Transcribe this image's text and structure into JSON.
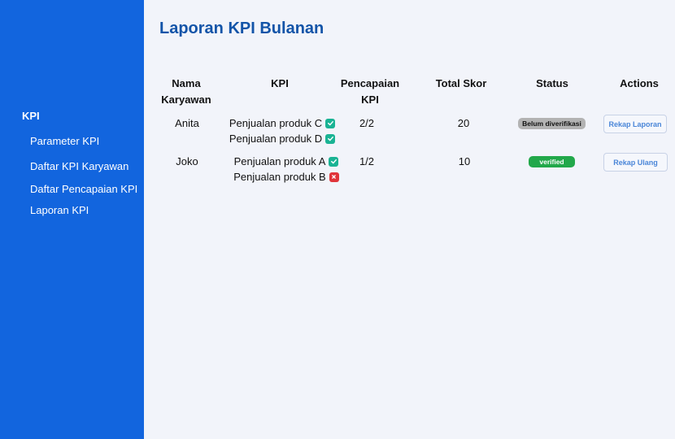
{
  "sidebar": {
    "section_label": "KPI",
    "items": [
      {
        "label": "Parameter KPI"
      },
      {
        "label": "Daftar KPI Karyawan"
      },
      {
        "label": "Daftar Pencapaian KPI"
      },
      {
        "label": "Laporan KPI"
      }
    ]
  },
  "page": {
    "title": "Laporan KPI Bulanan"
  },
  "table": {
    "headers": {
      "nama_line1": "Nama",
      "nama_line2": "Karyawan",
      "kpi": "KPI",
      "pencapaian_line1": "Pencapaian",
      "pencapaian_line2": "KPI",
      "total": "Total Skor",
      "status": "Status",
      "actions": "Actions"
    },
    "rows": [
      {
        "name": "Anita",
        "kpis": [
          {
            "label": "Penjualan produk C",
            "status_icon": "check-icon"
          },
          {
            "label": "Penjualan produk D",
            "status_icon": "check-icon"
          }
        ],
        "achievement": "2/2",
        "total": "20",
        "status": "Belum diverifikasi",
        "status_color": "#b3b3b3",
        "action": "Rekap Laporan"
      },
      {
        "name": "Joko",
        "kpis": [
          {
            "label": "Penjualan produk A",
            "status_icon": "check-icon"
          },
          {
            "label": "Penjualan produk B",
            "status_icon": "x-icon"
          }
        ],
        "achievement": "1/2",
        "total": "10",
        "status": "verified",
        "status_color": "#22a84a",
        "action": "Rekap Ulang"
      }
    ]
  },
  "colors": {
    "sidebar_bg": "#1265de",
    "title": "#1354a8",
    "check": "#1ab394",
    "cross": "#e0343a"
  }
}
